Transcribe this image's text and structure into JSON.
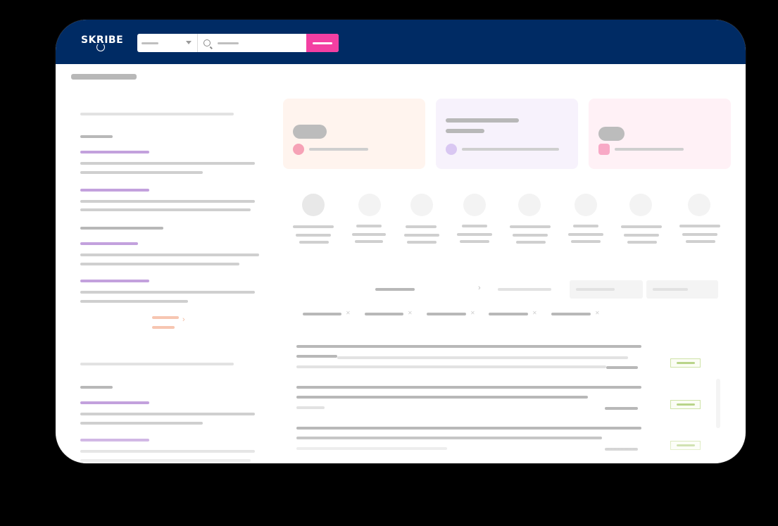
{
  "brand": {
    "name": "SKRIBE"
  },
  "colors": {
    "topbar": "#002b64",
    "accent_pink": "#f33fa2",
    "link_purple": "#c3a1dd",
    "orange": "#f7c6b1",
    "tag_green": "#b9d48a"
  },
  "icons": {
    "search": "search-icon",
    "caret": "chevron-down-icon",
    "chevron": "chevron-right-icon",
    "close": "close-icon",
    "user": "user-icon",
    "clock": "clock-icon",
    "chat": "chat-icon"
  }
}
